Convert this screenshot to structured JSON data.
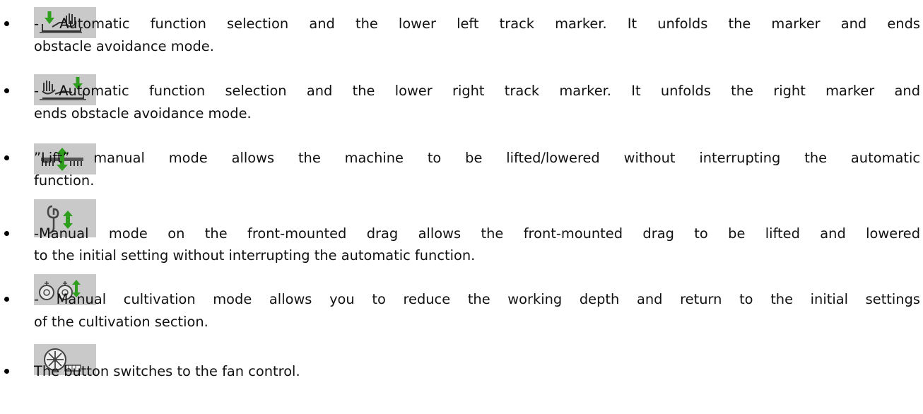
{
  "colors": {
    "icon_background": "#c9c9c9",
    "icon_green": "#2f9e1f",
    "icon_line": "#333333"
  },
  "items": [
    {
      "icon": "marker-left-hand-icon",
      "line1": "- Automatic function selection and the lower left track marker. It unfolds the marker and ends",
      "line2": "obstacle avoidance mode."
    },
    {
      "icon": "hand-marker-right-icon",
      "line1": "- Automatic function selection and the lower right track marker. It unfolds the right marker and",
      "line2": "ends obstacle avoidance mode."
    },
    {
      "icon": "lift-machine-icon",
      "line1": "”Lift” manual mode allows the machine to be lifted/lowered without interrupting the automatic",
      "line2": "function."
    },
    {
      "icon": "front-drag-icon",
      "line1": "-Manual mode on the front-mounted drag allows the front-mounted drag to be lifted and lowered",
      "line2": "to the initial setting without interrupting the automatic function."
    },
    {
      "icon": "cultivation-discs-icon",
      "line1": "- Manual cultivation mode allows you to reduce the working depth and return to the initial settings",
      "line2": "of the cultivation section."
    },
    {
      "icon": "fan-control-icon",
      "line1": "The button switches to the fan control."
    }
  ]
}
